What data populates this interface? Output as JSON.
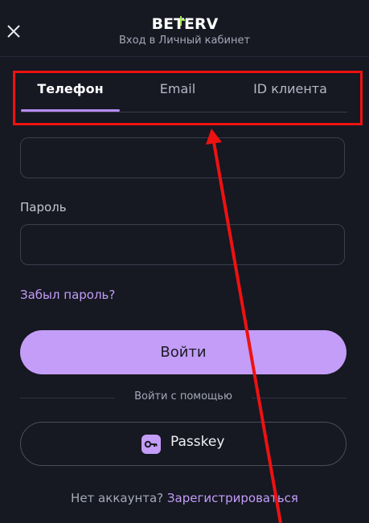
{
  "header": {
    "logo_text": "BETERV",
    "subtitle": "Вход в Личный кабинет"
  },
  "tabs": [
    {
      "label": "Телефон",
      "active": true
    },
    {
      "label": "Email",
      "active": false
    },
    {
      "label": "ID клиента",
      "active": false
    }
  ],
  "form": {
    "phone_value": "",
    "password_label": "Пароль",
    "password_value": "",
    "forgot_password": "Забыл пароль?",
    "login_button": "Войти",
    "alt_login_text": "Войти с помощью",
    "passkey_button": "Passkey"
  },
  "signup": {
    "prompt": "Нет аккаунта?",
    "link": "Зарегистрироваться"
  },
  "colors": {
    "background": "#161822",
    "accent": "#c39df7",
    "annotation": "#ee1111"
  }
}
